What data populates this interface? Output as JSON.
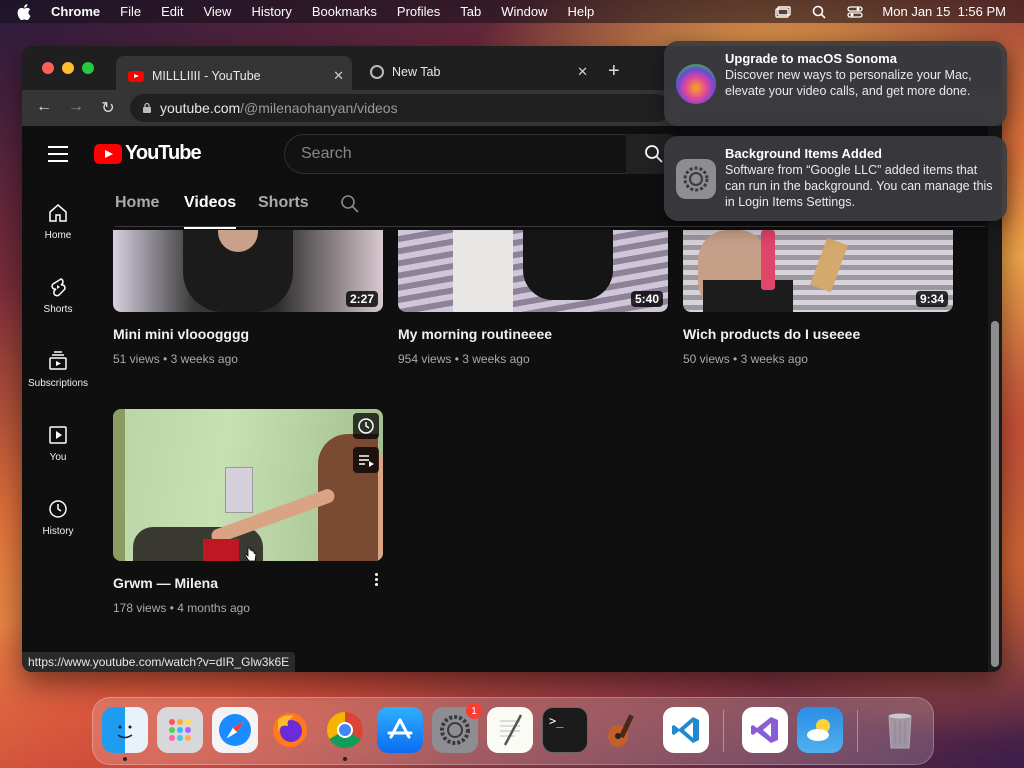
{
  "menubar": {
    "app": "Chrome",
    "items": [
      "File",
      "Edit",
      "View",
      "History",
      "Bookmarks",
      "Profiles",
      "Tab",
      "Window",
      "Help"
    ],
    "clock": "Mon Jan 15  1:56 PM"
  },
  "browser": {
    "tabs": [
      {
        "title": "MILLLIIII - YouTube",
        "active": true
      },
      {
        "title": "New Tab",
        "active": false
      }
    ],
    "url_host": "youtube.com",
    "url_path": "/@milenaohanyan/videos",
    "status_url": "https://www.youtube.com/watch?v=dIR_Glw3k6E"
  },
  "youtube": {
    "logo_text": "YouTube",
    "search_placeholder": "Search",
    "sidenav": [
      {
        "label": "Home",
        "icon": "home-icon"
      },
      {
        "label": "Shorts",
        "icon": "shorts-icon"
      },
      {
        "label": "Subscriptions",
        "icon": "subscriptions-icon"
      },
      {
        "label": "You",
        "icon": "you-icon"
      },
      {
        "label": "History",
        "icon": "history-icon"
      }
    ],
    "channel_tabs": [
      "Home",
      "Videos",
      "Shorts"
    ],
    "active_tab": "Videos",
    "videos": [
      {
        "title": "Mini mini vlooogggg",
        "views": "51 views",
        "age": "3 weeks ago",
        "duration": "2:27"
      },
      {
        "title": "My morning routineeee",
        "views": "954 views",
        "age": "3 weeks ago",
        "duration": "5:40"
      },
      {
        "title": "Wich products do I useeee",
        "views": "50 views",
        "age": "3 weeks ago",
        "duration": "9:34"
      },
      {
        "title": "Grwm — Milena",
        "views": "178 views",
        "age": "4 months ago",
        "duration": ""
      }
    ]
  },
  "notifications": [
    {
      "title": "Upgrade to macOS Sonoma",
      "body": "Discover new ways to personalize your Mac, elevate your video calls, and get more done."
    },
    {
      "title": "Background Items Added",
      "body": "Software from “Google LLC” added items that can run in the background. You can manage this in Login Items Settings."
    }
  ],
  "dock": {
    "apps": [
      "finder",
      "launchpad",
      "safari",
      "firefox",
      "chrome",
      "app-store",
      "system-settings",
      "textedit",
      "terminal",
      "garageband",
      "vscode",
      "visual-studio",
      "weather",
      "trash"
    ],
    "system_settings_badge": "1"
  },
  "colors": {
    "yt_red": "#ff0000",
    "accent": "#ffffff",
    "bg": "#0f0f0f"
  }
}
